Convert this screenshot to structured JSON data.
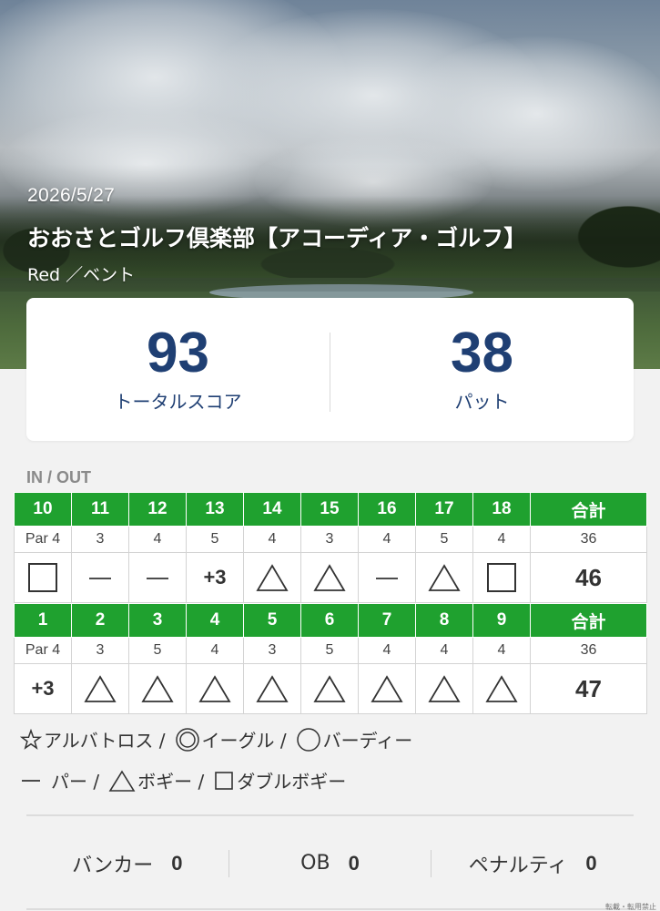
{
  "round": {
    "date": "2026/5/27",
    "course_name": "おおさとゴルフ倶楽部【アコーディア・ゴルフ】",
    "tee": "Red ／ベント"
  },
  "summary": {
    "total_score": "93",
    "total_score_label": "トータルスコア",
    "putts": "38",
    "putts_label": "パット"
  },
  "section_label": "IN / OUT",
  "scorecard": {
    "total_label": "合計",
    "in": {
      "holes": [
        "10",
        "11",
        "12",
        "13",
        "14",
        "15",
        "16",
        "17",
        "18"
      ],
      "pars": [
        "Par 4",
        "3",
        "4",
        "5",
        "4",
        "3",
        "4",
        "5",
        "4"
      ],
      "par_total": "36",
      "results": [
        "square",
        "dash",
        "dash",
        "+3",
        "triangle",
        "triangle",
        "dash",
        "triangle",
        "square"
      ],
      "score_total": "46"
    },
    "out": {
      "holes": [
        "1",
        "2",
        "3",
        "4",
        "5",
        "6",
        "7",
        "8",
        "9"
      ],
      "pars": [
        "Par 4",
        "3",
        "5",
        "4",
        "3",
        "5",
        "4",
        "4",
        "4"
      ],
      "par_total": "36",
      "results": [
        "+3",
        "triangle",
        "triangle",
        "triangle",
        "triangle",
        "triangle",
        "triangle",
        "triangle",
        "triangle"
      ],
      "score_total": "47"
    }
  },
  "legend": {
    "albatross": "アルバトロス /",
    "eagle": "イーグル /",
    "birdie": "バーディー",
    "par": "パー /",
    "bogey": "ボギー /",
    "double_bogey": "ダブルボギー"
  },
  "stats": {
    "bunker_label": "バンカー",
    "bunker_value": "0",
    "ob_label": "OB",
    "ob_value": "0",
    "penalty_label": "ペナルティ",
    "penalty_value": "0"
  },
  "copyright": "転載・転用禁止",
  "colors": {
    "header_green": "#1fa12f",
    "score_navy": "#1f3f73"
  }
}
